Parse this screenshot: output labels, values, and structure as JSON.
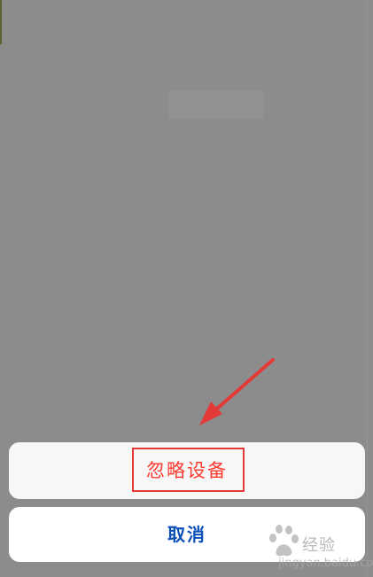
{
  "action_sheet": {
    "primary_option_label": "忽略设备",
    "cancel_label": "取消"
  },
  "annotations": {
    "highlight_color": "#e43a37",
    "arrow_color": "#e43a37"
  },
  "watermark": {
    "text": "经验",
    "url": "jingyan.baidu.com"
  },
  "colors": {
    "overlay": "rgba(0,0,0,0.45)",
    "sheet_background": "#f7f7f7",
    "cancel_background": "#ffffff",
    "destructive_text": "#ff3b30",
    "cancel_text": "#0a4fb8"
  }
}
